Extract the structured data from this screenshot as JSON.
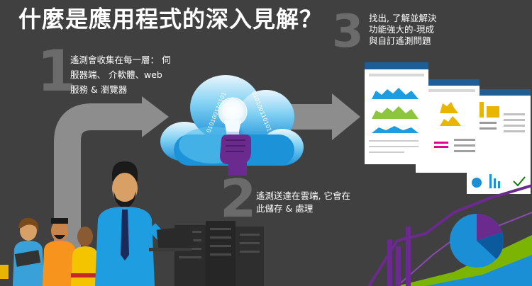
{
  "title": "什麼是應用程式的深入見解？",
  "steps": [
    {
      "number": "1",
      "lines": [
        "遙測會收集在每一層： 伺",
        "服器端、 介軟體、web",
        "服務 & 瀏覽器"
      ]
    },
    {
      "number": "2",
      "lines": [
        "遙測送達在雲端, 它會在",
        "此儲存 & 處理"
      ]
    },
    {
      "number": "3",
      "lines": [
        "找出, 了解並解決",
        "功能強大的-現成",
        "與自訂遙測問題"
      ]
    }
  ],
  "cloud_binary": "010100110101",
  "colors": {
    "background": "#404040",
    "arrow": "#8a8a8a",
    "step_number": "#6a6a6a",
    "cloud_top": "#e7f5fc",
    "cloud_bottom": "#1ba1e2",
    "accent_purple": "#68217a",
    "accent_green": "#8cc63f",
    "accent_blue": "#0078d7"
  }
}
